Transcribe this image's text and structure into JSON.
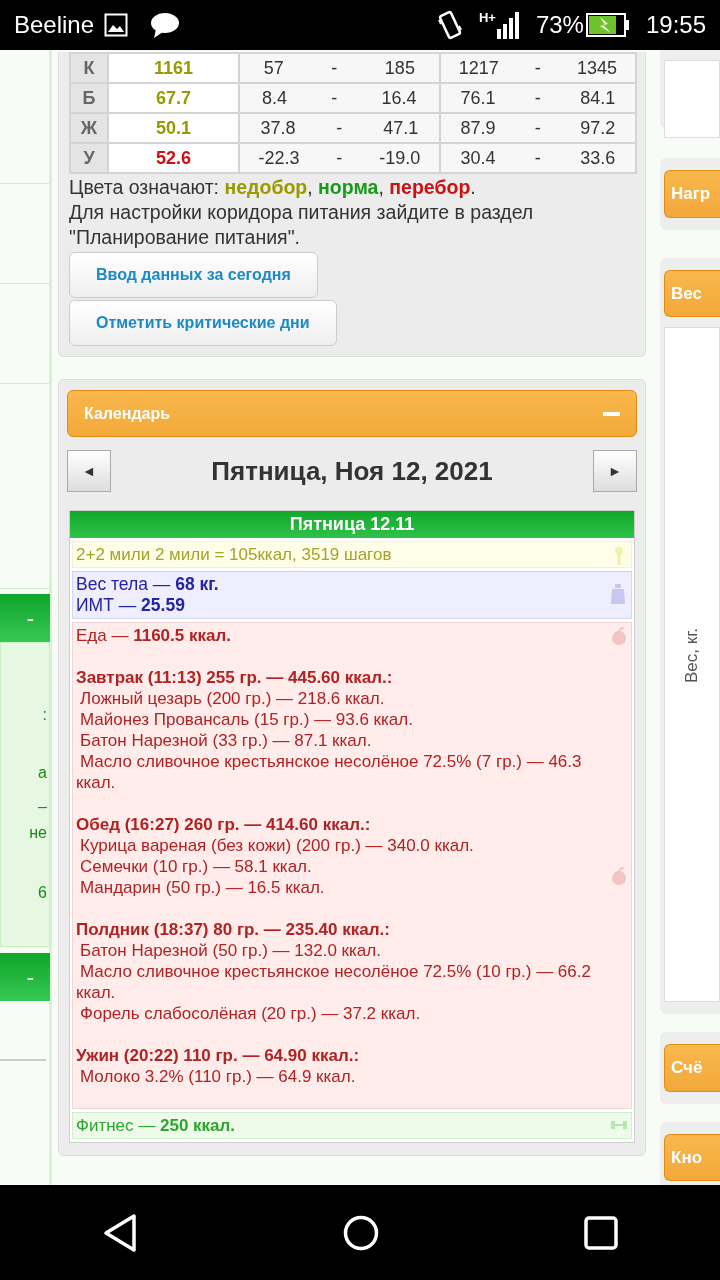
{
  "status_bar": {
    "carrier": "Beeline",
    "network": "H+",
    "battery": "73%",
    "time": "19:55"
  },
  "left_panel": {
    "headers": [
      "-",
      "-"
    ],
    "fragments": [
      ":",
      "а",
      "–",
      "не",
      "6"
    ]
  },
  "nutrients": [
    {
      "letter": "К",
      "value": "1161",
      "color": "#999900",
      "range1": [
        "57",
        "185"
      ],
      "range2": [
        "1217",
        "1345"
      ]
    },
    {
      "letter": "Б",
      "value": "67.7",
      "color": "#999900",
      "range1": [
        "8.4",
        "16.4"
      ],
      "range2": [
        "76.1",
        "84.1"
      ]
    },
    {
      "letter": "Ж",
      "value": "50.1",
      "color": "#999900",
      "range1": [
        "37.8",
        "47.1"
      ],
      "range2": [
        "87.9",
        "97.2"
      ]
    },
    {
      "letter": "У",
      "value": "52.6",
      "color": "#d01010",
      "range1": [
        "-22.3",
        "-19.0"
      ],
      "range2": [
        "30.4",
        "33.6"
      ]
    }
  ],
  "range_separator": "-",
  "legend": {
    "text": "Цвета означают: **недобор**, **норма**, **перебор**.",
    "terms": [
      {
        "color": "#999900"
      },
      {
        "color": "#1a9a1a"
      },
      {
        "color": "#d01010"
      }
    ],
    "note": "Для настройки коридора питания зайдите в раздел \"Планирование питания\"."
  },
  "buttons": [
    "Ввод данных за сегодня",
    "Отметить критические дни"
  ],
  "calendar": {
    "title": "Календарь",
    "prev": "◄",
    "next": "►",
    "date": "Пятница, Ноя 12, 2021",
    "day_title": "Пятница 12.11",
    "activity": "2+2 мили 2 мили = 105ккал, 3519 шагов",
    "weight": {
      "label": "Вес тела — ",
      "value": "68 кг.",
      "bmi_label": "ИМТ — ",
      "bmi": "25.59"
    },
    "food": {
      "label": "Еда — ",
      "total": "1160.5 ккал.",
      "meals": [
        {
          "title": "Завтрак (11:13) 255 гр. — 445.60 ккал.:",
          "items": [
            "Ложный цезарь (200 гр.) — 218.6 ккал.",
            "Майонез Провансаль (15 гр.) — 93.6 ккал.",
            "Батон Нарезной (33 гр.) — 87.1 ккал.",
            "Масло сливочное крестьянское несолёное 72.5% (7 гр.) — 46.3 ккал."
          ]
        },
        {
          "title": "Обед (16:27) 260 гр. — 414.60 ккал.:",
          "items": [
            "Курица вареная (без кожи) (200 гр.) — 340.0 ккал.",
            "Семечки (10 гр.) — 58.1 ккал.",
            "Мандарин (50 гр.) — 16.5 ккал."
          ]
        },
        {
          "title": "Полдник (18:37) 80 гр. — 235.40 ккал.:",
          "items": [
            "Батон Нарезной (50 гр.) — 132.0 ккал.",
            "Масло сливочное крестьянское несолёное 72.5% (10 гр.) — 66.2 ккал.",
            "Форель слабосолёная (20 гр.) — 37.2 ккал."
          ]
        },
        {
          "title": "Ужин (20:22) 110 гр. — 64.90 ккал.:",
          "items": [
            "Молоко 3.2% (110 гр.) — 64.9 ккал."
          ]
        }
      ]
    },
    "fitness": {
      "label": "Фитнес — ",
      "value": "250 ккал."
    }
  },
  "right_panel": {
    "buttons": [
      "Нагр",
      "Вес",
      "Счё",
      "Кно"
    ],
    "axis_label": "Вес, кг."
  }
}
